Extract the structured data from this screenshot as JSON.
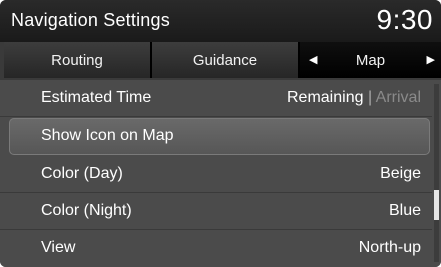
{
  "header": {
    "title": "Navigation Settings",
    "time": "9:30"
  },
  "tabs": [
    {
      "label": "Routing"
    },
    {
      "label": "Guidance"
    },
    {
      "label": "Map",
      "left_arrow": "◀",
      "right_arrow": "▶"
    }
  ],
  "items": [
    {
      "label": "Estimated Time",
      "value_active": "Remaining",
      "value_sep": "|",
      "value_inactive": "Arrival"
    },
    {
      "label": "Show Icon on Map"
    },
    {
      "label": "Color (Day)",
      "value": "Beige"
    },
    {
      "label": "Color (Night)",
      "value": "Blue"
    },
    {
      "label": "View",
      "value": "North-up"
    }
  ],
  "selected_item": "Show Icon on Map",
  "colors": {
    "background": "#4b4b4b",
    "header": "#1a1a1a",
    "selected": "#5f5f5f",
    "inactive_text": "#8a8a8a"
  }
}
